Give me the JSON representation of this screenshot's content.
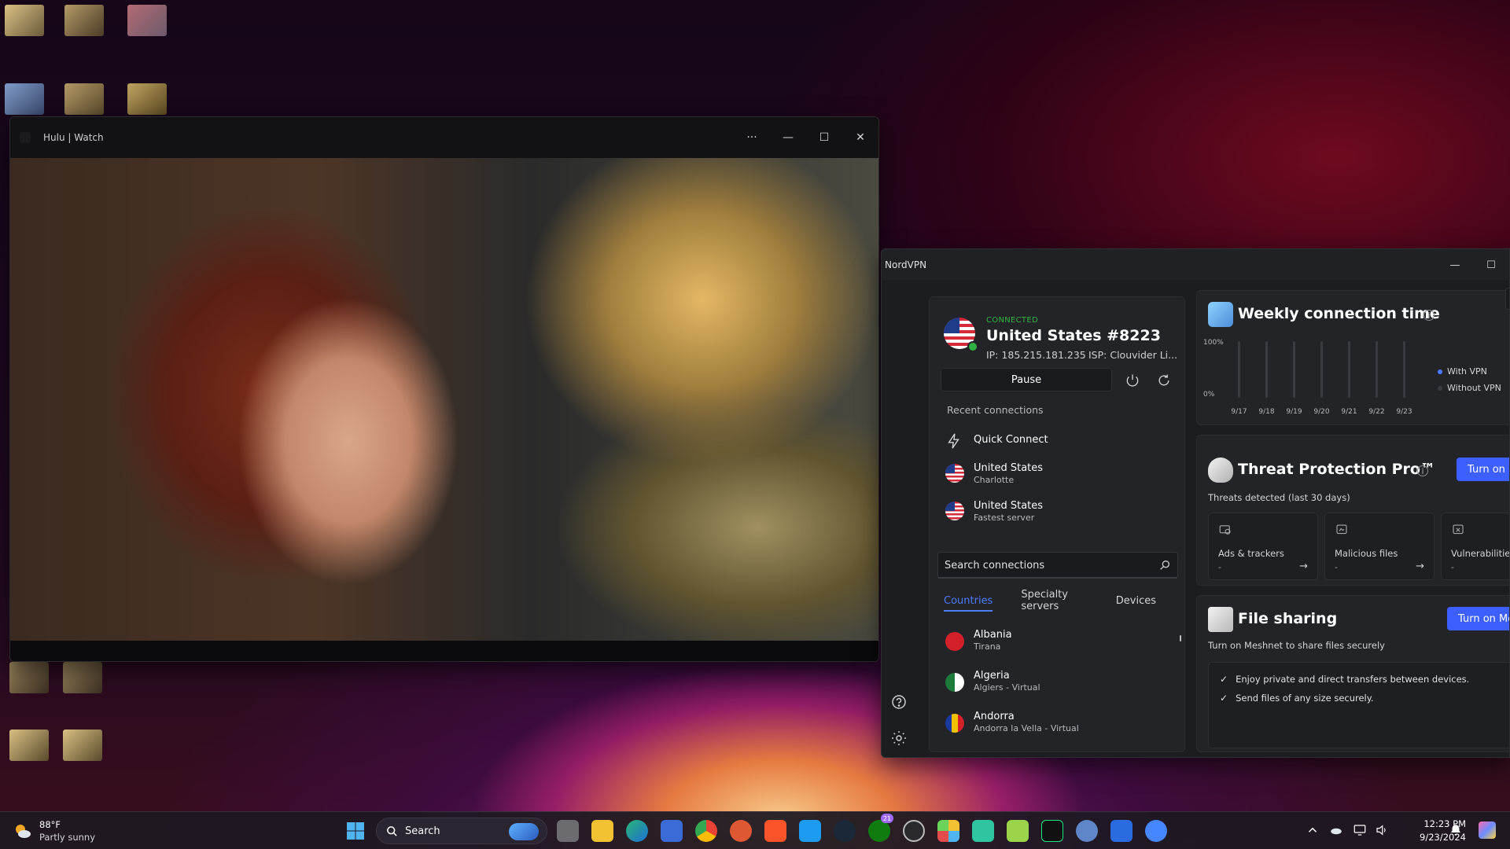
{
  "hulu": {
    "title": "Hulu | Watch",
    "more": "···",
    "minimize": "—",
    "maximize": "☐",
    "close": "✕"
  },
  "nord": {
    "title": "NordVPN",
    "minimize": "—",
    "maximize": "☐",
    "connection": {
      "status": "CONNECTED",
      "server": "United States #8223",
      "ip": "IP: 185.215.181.235",
      "isp": "ISP: Clouvider Li..."
    },
    "pause_label": "Pause",
    "recent_label": "Recent connections",
    "recent": [
      {
        "name": "Quick Connect",
        "sub": ""
      },
      {
        "name": "United States",
        "sub": "Charlotte"
      },
      {
        "name": "United States",
        "sub": "Fastest server"
      }
    ],
    "search": {
      "placeholder": "Search connections"
    },
    "tabs": [
      {
        "label": "Countries",
        "active": true
      },
      {
        "label": "Specialty servers",
        "active": false
      },
      {
        "label": "Devices",
        "active": false
      }
    ],
    "countries": [
      {
        "name": "Albania",
        "sub": "Tirana",
        "color": "#d4202a"
      },
      {
        "name": "Algeria",
        "sub": "Algiers - Virtual",
        "color": "#1c7a3a"
      },
      {
        "name": "Andorra",
        "sub": "Andorra la Vella - Virtual",
        "color": "#f2c200"
      }
    ],
    "weekly": {
      "title": "Weekly connection time",
      "legend_with": "With VPN",
      "legend_without": "Without VPN",
      "with_color": "#4d7cff",
      "without_color": "#3a3b40"
    },
    "threat": {
      "title": "Threat Protection Pro™",
      "button": "Turn on",
      "subtitle": "Threats detected (last 30 days)",
      "stats": [
        {
          "label": "Ads & trackers",
          "value": "-"
        },
        {
          "label": "Malicious files",
          "value": "-"
        },
        {
          "label": "Vulnerabilities",
          "value": "-"
        }
      ]
    },
    "sharing": {
      "title": "File sharing",
      "button": "Turn on Meshnet",
      "subtitle": "Turn on Meshnet to share files securely",
      "features": [
        "Enjoy private and direct transfers between devices.",
        "Send files of any size securely."
      ]
    }
  },
  "chart_data": {
    "type": "bar",
    "categories": [
      "9/17",
      "9/18",
      "9/19",
      "9/20",
      "9/21",
      "9/22",
      "9/23"
    ],
    "series": [
      {
        "name": "With VPN",
        "values": [
          0,
          0,
          0,
          0,
          0,
          0,
          0
        ]
      },
      {
        "name": "Without VPN",
        "values": [
          0,
          0,
          0,
          0,
          0,
          0,
          0
        ]
      }
    ],
    "yticks": [
      "100%",
      "0%"
    ],
    "ylim": [
      0,
      100
    ],
    "legend": "right"
  },
  "taskbar": {
    "weather_temp": "88°F",
    "weather_desc": "Partly sunny",
    "search_label": "Search",
    "xbox_badge": "21",
    "time": "12:23 PM",
    "date": "9/23/2024"
  }
}
